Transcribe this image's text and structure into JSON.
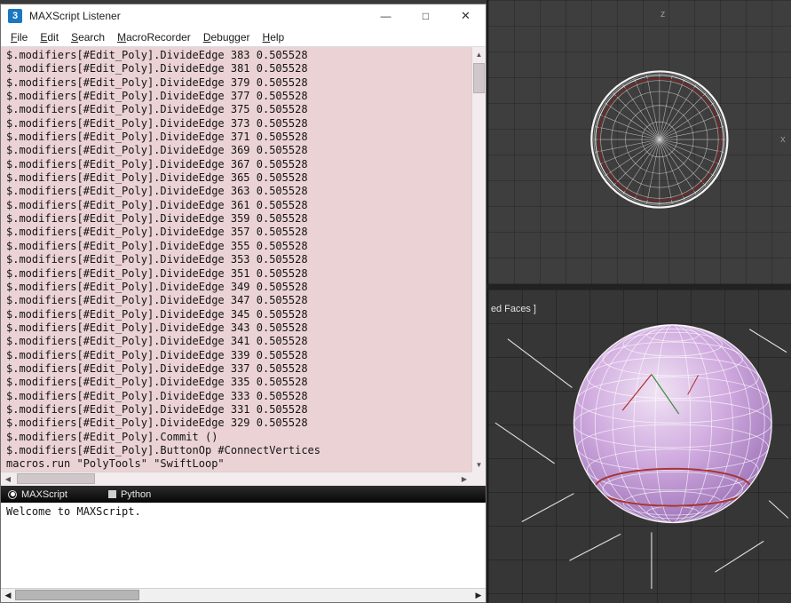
{
  "window": {
    "title": "MAXScript Listener",
    "icon": "3",
    "minimize": "—",
    "maximize": "□",
    "close": "✕"
  },
  "menu": {
    "items": [
      "File",
      "Edit",
      "Search",
      "MacroRecorder",
      "Debugger",
      "Help"
    ]
  },
  "listener": {
    "lines": [
      "$.modifiers[#Edit_Poly].DivideEdge 383 0.505528",
      "$.modifiers[#Edit_Poly].DivideEdge 381 0.505528",
      "$.modifiers[#Edit_Poly].DivideEdge 379 0.505528",
      "$.modifiers[#Edit_Poly].DivideEdge 377 0.505528",
      "$.modifiers[#Edit_Poly].DivideEdge 375 0.505528",
      "$.modifiers[#Edit_Poly].DivideEdge 373 0.505528",
      "$.modifiers[#Edit_Poly].DivideEdge 371 0.505528",
      "$.modifiers[#Edit_Poly].DivideEdge 369 0.505528",
      "$.modifiers[#Edit_Poly].DivideEdge 367 0.505528",
      "$.modifiers[#Edit_Poly].DivideEdge 365 0.505528",
      "$.modifiers[#Edit_Poly].DivideEdge 363 0.505528",
      "$.modifiers[#Edit_Poly].DivideEdge 361 0.505528",
      "$.modifiers[#Edit_Poly].DivideEdge 359 0.505528",
      "$.modifiers[#Edit_Poly].DivideEdge 357 0.505528",
      "$.modifiers[#Edit_Poly].DivideEdge 355 0.505528",
      "$.modifiers[#Edit_Poly].DivideEdge 353 0.505528",
      "$.modifiers[#Edit_Poly].DivideEdge 351 0.505528",
      "$.modifiers[#Edit_Poly].DivideEdge 349 0.505528",
      "$.modifiers[#Edit_Poly].DivideEdge 347 0.505528",
      "$.modifiers[#Edit_Poly].DivideEdge 345 0.505528",
      "$.modifiers[#Edit_Poly].DivideEdge 343 0.505528",
      "$.modifiers[#Edit_Poly].DivideEdge 341 0.505528",
      "$.modifiers[#Edit_Poly].DivideEdge 339 0.505528",
      "$.modifiers[#Edit_Poly].DivideEdge 337 0.505528",
      "$.modifiers[#Edit_Poly].DivideEdge 335 0.505528",
      "$.modifiers[#Edit_Poly].DivideEdge 333 0.505528",
      "$.modifiers[#Edit_Poly].DivideEdge 331 0.505528",
      "$.modifiers[#Edit_Poly].DivideEdge 329 0.505528",
      "$.modifiers[#Edit_Poly].Commit ()",
      "$.modifiers[#Edit_Poly].ButtonOp #ConnectVertices",
      "macros.run \"PolyTools\" \"SwiftLoop\""
    ]
  },
  "tabbar": {
    "maxscript": "MAXScript",
    "python": "Python"
  },
  "output": {
    "text": "Welcome to MAXScript."
  },
  "scrollbar": {
    "up": "▲",
    "down": "▼",
    "left": "◀",
    "right": "▶"
  },
  "viewports": {
    "top": {
      "axis_top": "z",
      "axis_right": "x"
    },
    "bottom": {
      "label": "ed Faces ]"
    }
  },
  "colors": {
    "listener_bg": "#ead2d5",
    "viewport_bg": "#3e3e3e",
    "sphere_fill": "#c9a4d8",
    "selection_red": "#a63535",
    "wireframe": "#ffffff"
  }
}
